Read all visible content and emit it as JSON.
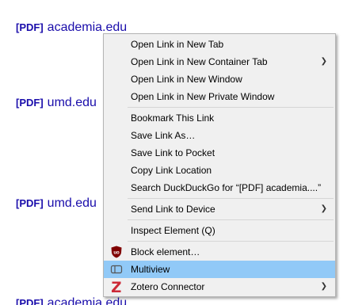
{
  "results": [
    {
      "tag": "[PDF]",
      "site": "academia.edu"
    },
    {
      "tag": "[PDF]",
      "site": "umd.edu"
    },
    {
      "tag": "[PDF]",
      "site": "umd.edu"
    },
    {
      "tag": "[PDF]",
      "site": "academia.edu"
    }
  ],
  "menu": {
    "open_new_tab": "Open Link in New Tab",
    "open_container_tab": "Open Link in New Container Tab",
    "open_new_window": "Open Link in New Window",
    "open_private_window": "Open Link in New Private Window",
    "bookmark_link": "Bookmark This Link",
    "save_link_as": "Save Link As…",
    "save_to_pocket": "Save Link to Pocket",
    "copy_link_location": "Copy Link Location",
    "search_duckduckgo": "Search DuckDuckGo for “[PDF] academia....”",
    "send_to_device": "Send Link to Device",
    "inspect_element": "Inspect Element (Q)",
    "block_element": "Block element…",
    "multiview": "Multiview",
    "zotero_connector": "Zotero Connector"
  },
  "icons": {
    "ublock": "ublock-shield-icon",
    "multiview": "multiview-icon",
    "zotero": "zotero-z-icon"
  },
  "colors": {
    "link": "#1a0dab",
    "menu_background": "#f0f0f0",
    "highlight": "#91c9f7",
    "ublock_red": "#800000",
    "zotero_red": "#cc2936"
  }
}
